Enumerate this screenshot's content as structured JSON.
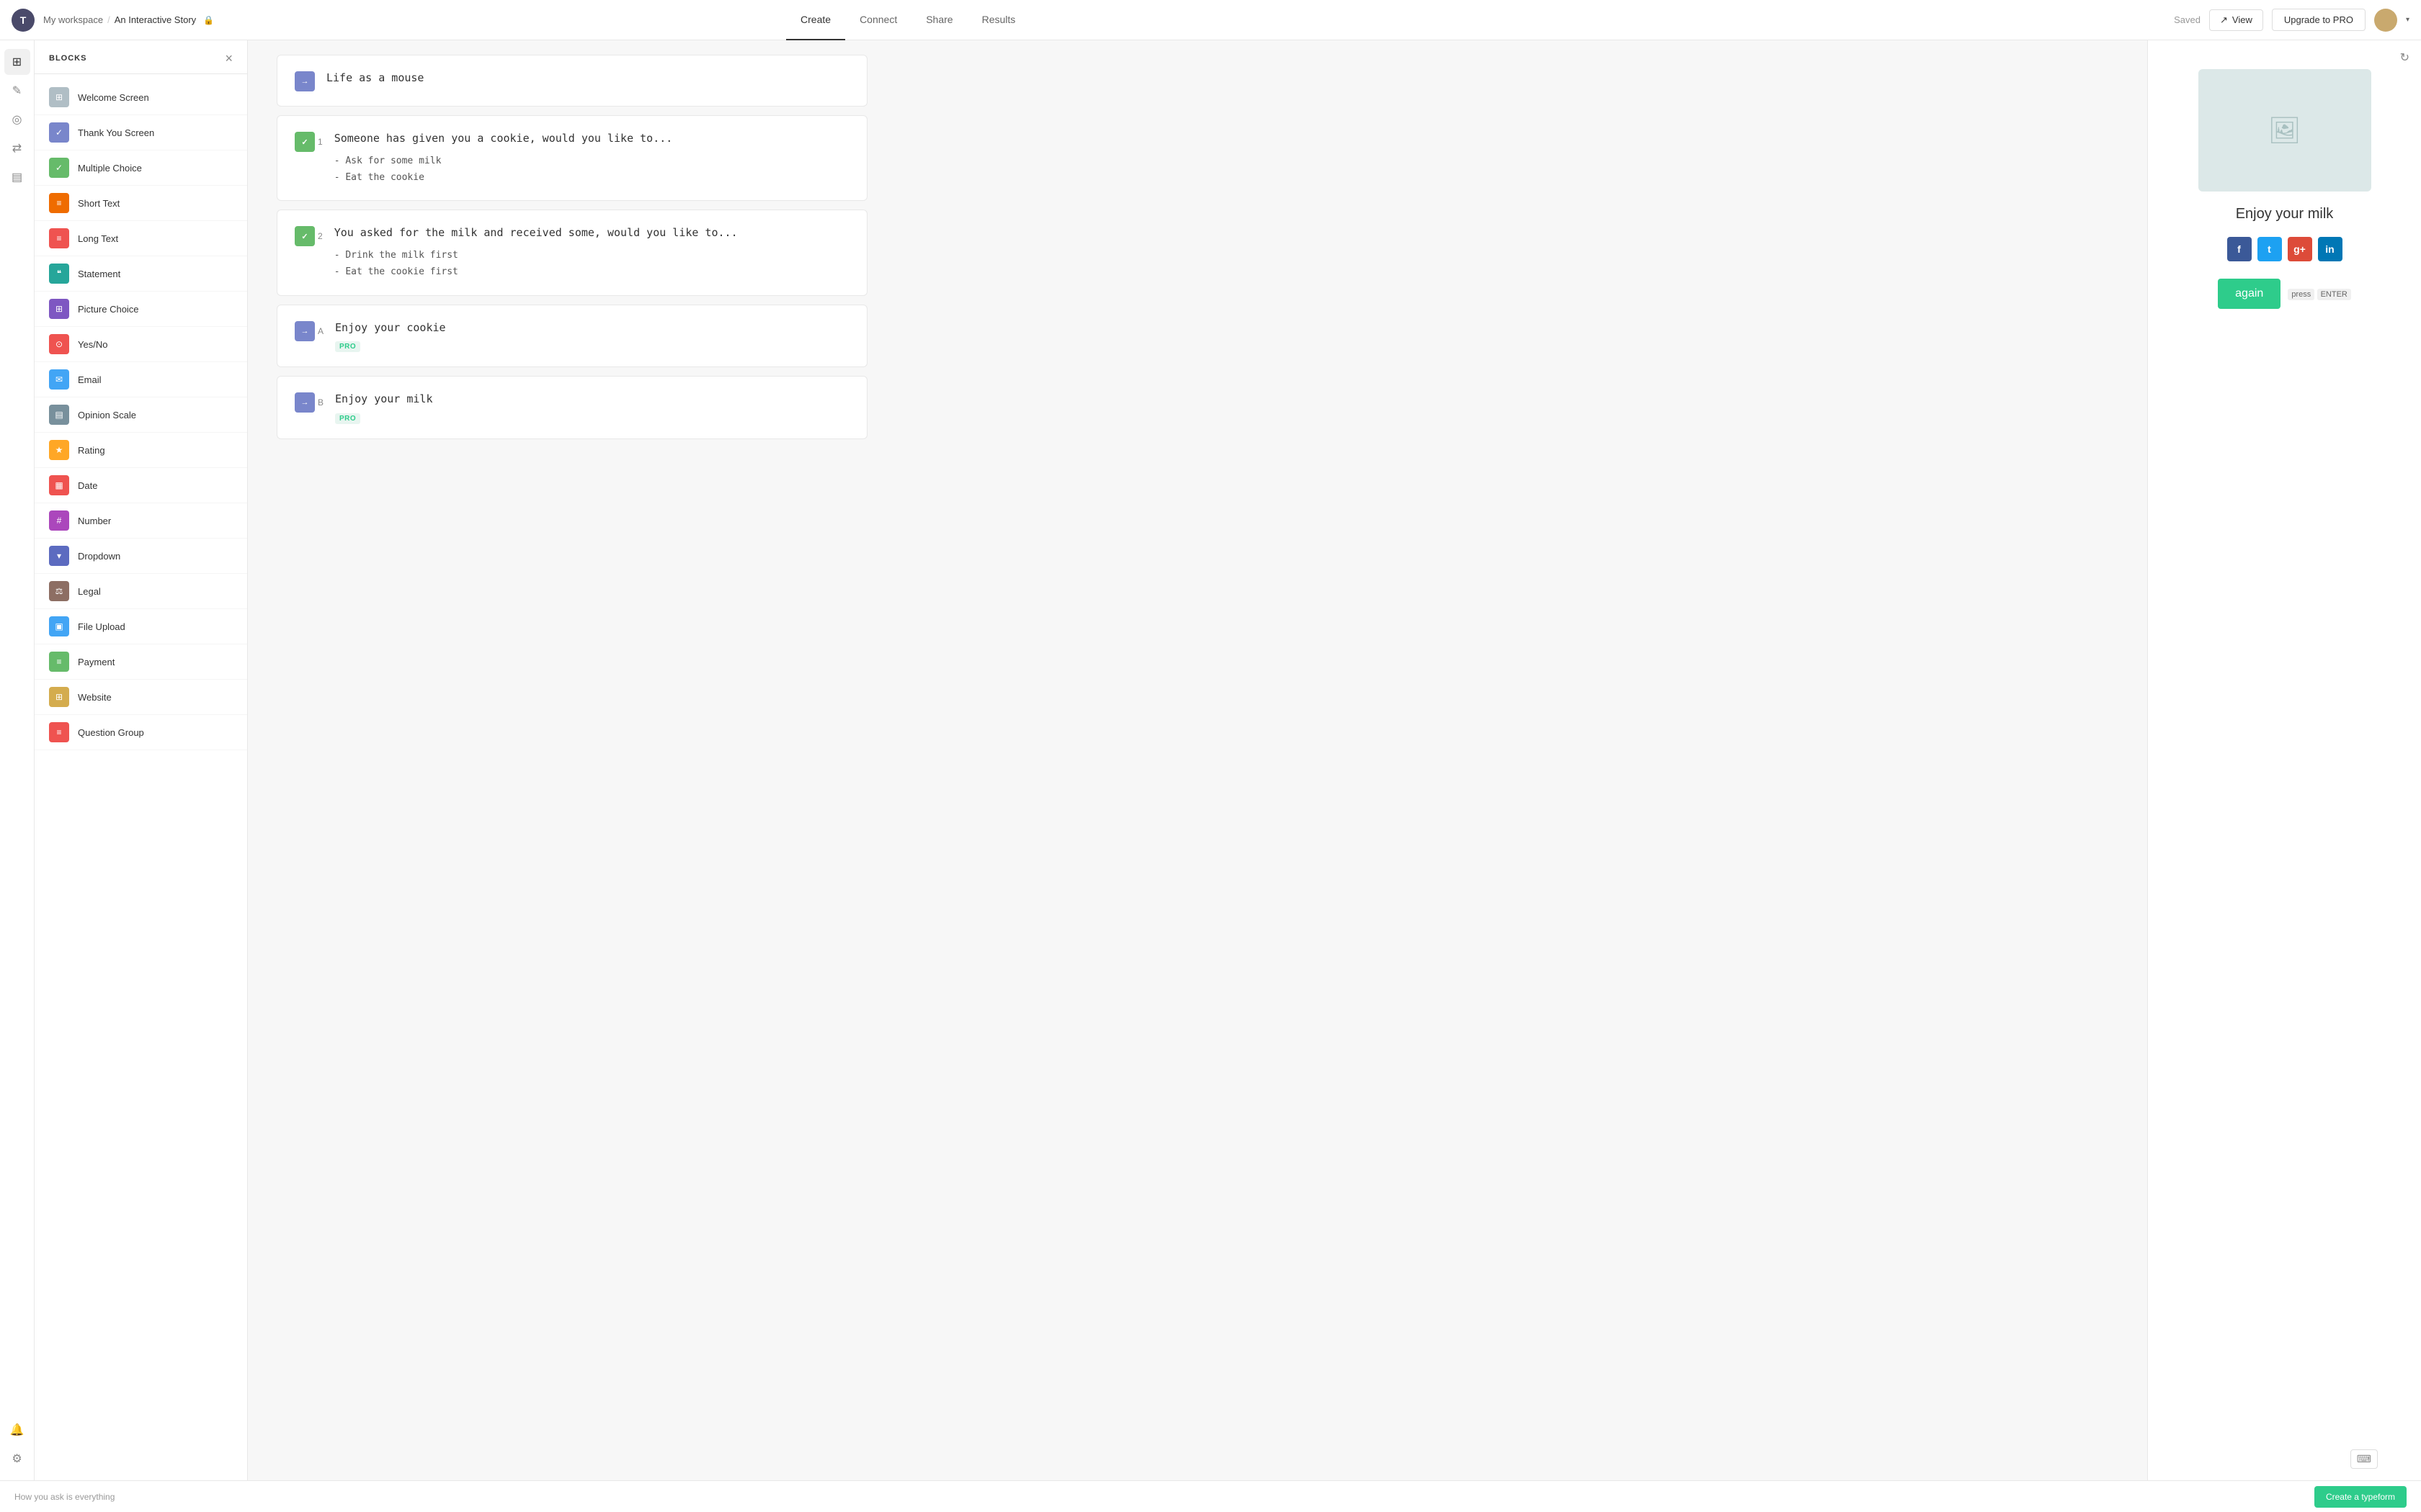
{
  "nav": {
    "logo": "T",
    "workspace": "My workspace",
    "separator": "/",
    "project": "An Interactive Story",
    "tabs": [
      "Create",
      "Connect",
      "Share",
      "Results"
    ],
    "active_tab": "Create",
    "saved": "Saved",
    "view_label": "View",
    "upgrade_label": "Upgrade to PRO"
  },
  "sidebar": {
    "title": "BLOCKS",
    "items": [
      {
        "label": "Welcome Screen",
        "color": "#b0bec5",
        "icon": "⊞"
      },
      {
        "label": "Thank You Screen",
        "color": "#7986cb",
        "icon": "✓"
      },
      {
        "label": "Multiple Choice",
        "color": "#66bb6a",
        "icon": "✓"
      },
      {
        "label": "Short Text",
        "color": "#ef6c00",
        "icon": "≡"
      },
      {
        "label": "Long Text",
        "color": "#ef5350",
        "icon": "≡"
      },
      {
        "label": "Statement",
        "color": "#26a69a",
        "icon": "❝"
      },
      {
        "label": "Picture Choice",
        "color": "#7e57c2",
        "icon": "⊞"
      },
      {
        "label": "Yes/No",
        "color": "#ef5350",
        "icon": "⊙"
      },
      {
        "label": "Email",
        "color": "#42a5f5",
        "icon": "✉"
      },
      {
        "label": "Opinion Scale",
        "color": "#78909c",
        "icon": "▤"
      },
      {
        "label": "Rating",
        "color": "#ffa726",
        "icon": "★"
      },
      {
        "label": "Date",
        "color": "#ef5350",
        "icon": "▦"
      },
      {
        "label": "Number",
        "color": "#ab47bc",
        "icon": "#"
      },
      {
        "label": "Dropdown",
        "color": "#5c6bc0",
        "icon": "▾"
      },
      {
        "label": "Legal",
        "color": "#8d6e63",
        "icon": "▦"
      },
      {
        "label": "File Upload",
        "color": "#42a5f5",
        "icon": "▣"
      },
      {
        "label": "Payment",
        "color": "#66bb6a",
        "icon": "≡"
      },
      {
        "label": "Website",
        "color": "#d4ac4e",
        "icon": "⊞"
      },
      {
        "label": "Question Group",
        "color": "#ef5350",
        "icon": "≡"
      }
    ]
  },
  "canvas": {
    "title_block": {
      "icon_color": "#7986cb",
      "icon": "→",
      "title": "Life as a mouse"
    },
    "blocks": [
      {
        "badge_color": "#66bb6a",
        "badge_icon": "✓",
        "badge_num": "1",
        "title": "Someone has given you a cookie, would you like to...",
        "options": [
          "- Ask for some milk",
          "- Eat the cookie"
        ]
      },
      {
        "badge_color": "#66bb6a",
        "badge_icon": "✓",
        "badge_num": "2",
        "title": "You asked for the milk and received some, would you like to...",
        "options": [
          "- Drink the milk first",
          "- Eat the cookie first"
        ]
      },
      {
        "badge_color": "#7986cb",
        "badge_icon": "→",
        "badge_letter": "A",
        "title": "Enjoy your cookie",
        "pro": "PRO"
      },
      {
        "badge_color": "#7986cb",
        "badge_icon": "→",
        "badge_letter": "B",
        "title": "Enjoy your milk",
        "pro": "PRO"
      }
    ]
  },
  "preview": {
    "title": "Enjoy your milk",
    "again_label": "again",
    "press_label": "press",
    "enter_label": "ENTER",
    "social": [
      {
        "letter": "f",
        "class": "si-fb"
      },
      {
        "letter": "t",
        "class": "si-tw"
      },
      {
        "letter": "g+",
        "class": "si-gp"
      },
      {
        "letter": "in",
        "class": "si-li"
      }
    ]
  },
  "bottom": {
    "tagline": "How you ask is everything",
    "cta": "Create a typeform"
  },
  "icons": {
    "left_bar": [
      "⊞",
      "✎",
      "◎",
      "⇄",
      "▤",
      "🔔",
      "⚙"
    ]
  }
}
